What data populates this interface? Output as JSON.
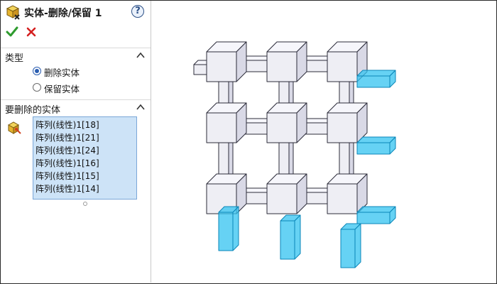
{
  "feature": {
    "title": "实体-删除/保留 1",
    "help_label": "?"
  },
  "type_section": {
    "title": "类型",
    "options": [
      {
        "label": "删除实体",
        "selected": true
      },
      {
        "label": "保留实体",
        "selected": false
      }
    ]
  },
  "bodies_section": {
    "title": "要删除的实体",
    "items": [
      "阵列(线性)1[18]",
      "阵列(线性)1[21]",
      "阵列(线性)1[24]",
      "阵列(线性)1[16]",
      "阵列(线性)1[15]",
      "阵列(线性)1[14]"
    ]
  },
  "colors": {
    "accept": "#2e9b2e",
    "cancel": "#d42020",
    "selection_bg": "#cde3f7",
    "highlight": "#33c3f0",
    "body": "#eeeef4"
  },
  "icons": [
    "feature-icon",
    "help-icon",
    "ok-check-icon",
    "cancel-x-icon",
    "collapse-chevron-icon",
    "solid-bodies-icon"
  ]
}
